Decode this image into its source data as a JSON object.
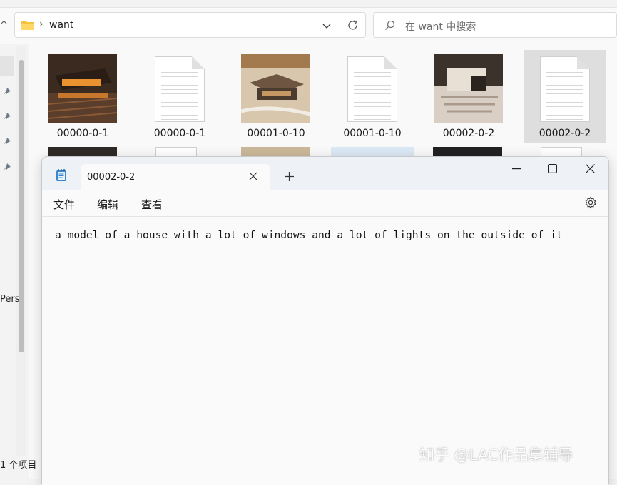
{
  "explorer": {
    "address_path": "want",
    "search_placeholder": "在 want 中搜索",
    "left_label": "Pers",
    "status_text": "1 个项目",
    "files": [
      {
        "name": "00000-0-1",
        "type": "image"
      },
      {
        "name": "00000-0-1",
        "type": "text"
      },
      {
        "name": "00001-0-10",
        "type": "image"
      },
      {
        "name": "00001-0-10",
        "type": "text"
      },
      {
        "name": "00002-0-2",
        "type": "image"
      },
      {
        "name": "00002-0-2",
        "type": "text",
        "selected": true
      }
    ]
  },
  "notepad": {
    "tab_title": "00002-0-2",
    "menus": {
      "file": "文件",
      "edit": "编辑",
      "view": "查看"
    },
    "content": "a model of a house with a lot of windows and a lot of lights on the outside of it"
  },
  "watermark": "知乎 @LAC作品集辅导",
  "colors": {
    "folder": "#f5c242",
    "title_bar": "#eef1f6",
    "selection": "#dedede"
  },
  "icons": [
    "folder-icon",
    "chevron-right-icon",
    "chevron-down-icon",
    "refresh-icon",
    "search-icon",
    "pin-icon",
    "notepad-app-icon",
    "close-icon",
    "plus-icon",
    "minimize-icon",
    "maximize-icon",
    "gear-icon"
  ]
}
